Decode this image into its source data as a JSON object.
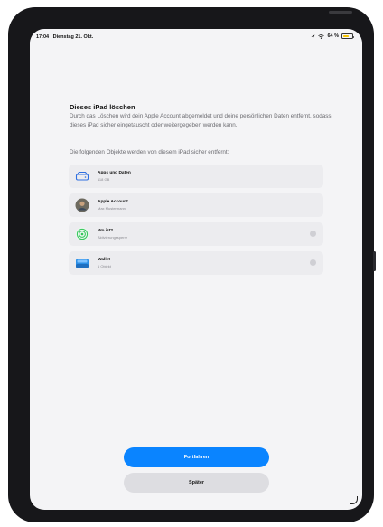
{
  "status": {
    "time": "17:04",
    "date": "Dienstag 21. Okt.",
    "battery": "64 %",
    "battery_level": 0.64
  },
  "page": {
    "title": "Dieses iPad löschen",
    "description": "Durch das Löschen wird dein Apple Account abgemeldet und deine persönlichen Daten entfernt, sodass dieses iPad sicher eingetauscht oder weitergegeben werden kann.",
    "subheading": "Die folgenden Objekte werden von diesem iPad sicher entfernt:"
  },
  "items": [
    {
      "title": "Apps und Daten",
      "subtitle": "118 GB",
      "icon": "storage-drive-icon",
      "has_info": false
    },
    {
      "title": "Apple Account",
      "subtitle": "Max Mustermann",
      "icon": "avatar-icon",
      "has_info": false
    },
    {
      "title": "Wo ist?",
      "subtitle": "Aktivierungssperre",
      "icon": "find-my-icon",
      "has_info": true
    },
    {
      "title": "Wallet",
      "subtitle": "1 Objekt",
      "icon": "wallet-icon",
      "has_info": true
    }
  ],
  "buttons": {
    "continue_label": "Fortfahren",
    "later_label": "Später"
  },
  "colors": {
    "accent": "#0a84ff",
    "battery": "#f5c400",
    "row_bg": "#ececef",
    "find_my": "#34c759",
    "wallet": "#2b8fe6"
  }
}
